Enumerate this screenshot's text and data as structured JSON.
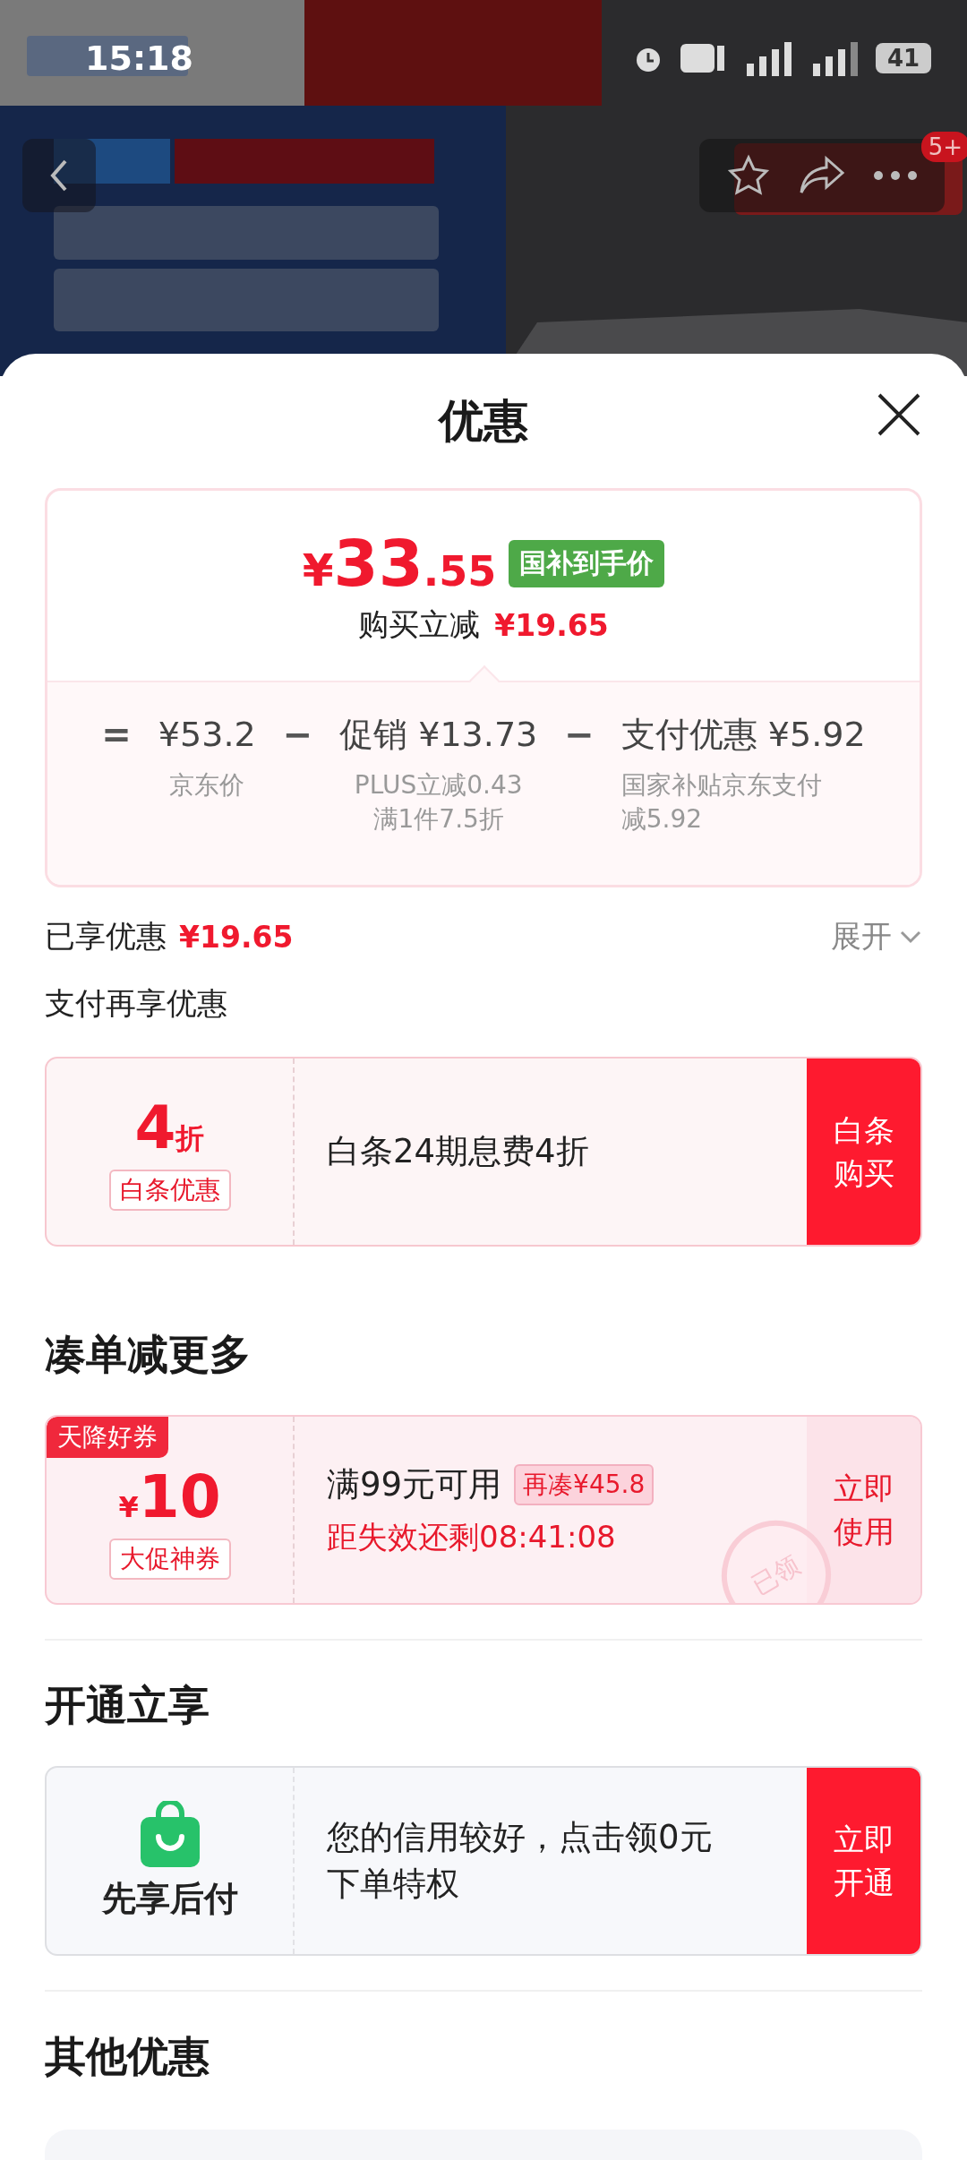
{
  "status_bar": {
    "time": "15:18",
    "battery": "41"
  },
  "top_bar": {
    "cart_badge": "5+"
  },
  "sheet": {
    "title": "优惠"
  },
  "price_card": {
    "currency": "¥",
    "price_integer": "33",
    "price_decimal": ".55",
    "price_tag": "国补到手价",
    "saving_label": "购买立减",
    "saving_amount": "¥19.65",
    "breakdown": [
      {
        "operator": "=",
        "value": "¥53.2",
        "notes": [
          "京东价"
        ]
      },
      {
        "operator": "−",
        "label": "促销",
        "value": "¥13.73",
        "notes": [
          "PLUS立减0.43",
          "满1件7.5折"
        ]
      },
      {
        "operator": "−",
        "label": "支付优惠",
        "value": "¥5.92",
        "notes": [
          "国家补贴京东支付减5.92"
        ]
      }
    ]
  },
  "enjoyed": {
    "label": "已享优惠",
    "amount": "¥19.65",
    "toggle": "展开",
    "expanded": false
  },
  "pay_section": {
    "title": "支付再享优惠",
    "offers": [
      {
        "big": "4",
        "unit": "折",
        "tag": "白条优惠",
        "text": "白条24期息费4折",
        "action": "白条购买"
      }
    ]
  },
  "bundle_section": {
    "title": "凑单减更多",
    "coupons": [
      {
        "ribbon": "天降好券",
        "currency": "¥",
        "amount": "10",
        "tag": "大促神券",
        "condition": "满99元可用",
        "chip": "再凑¥45.8",
        "countdown": "距失效还剩08:41:08",
        "action": "立即使用",
        "claimed": true,
        "stamp": "已领"
      }
    ]
  },
  "activate_section": {
    "title": "开通立享",
    "offers": [
      {
        "brand": "先享后付",
        "text": "您的信用较好，点击领0元下单特权",
        "action": "立即开通"
      }
    ]
  },
  "other_section": {
    "title": "其他优惠"
  }
}
